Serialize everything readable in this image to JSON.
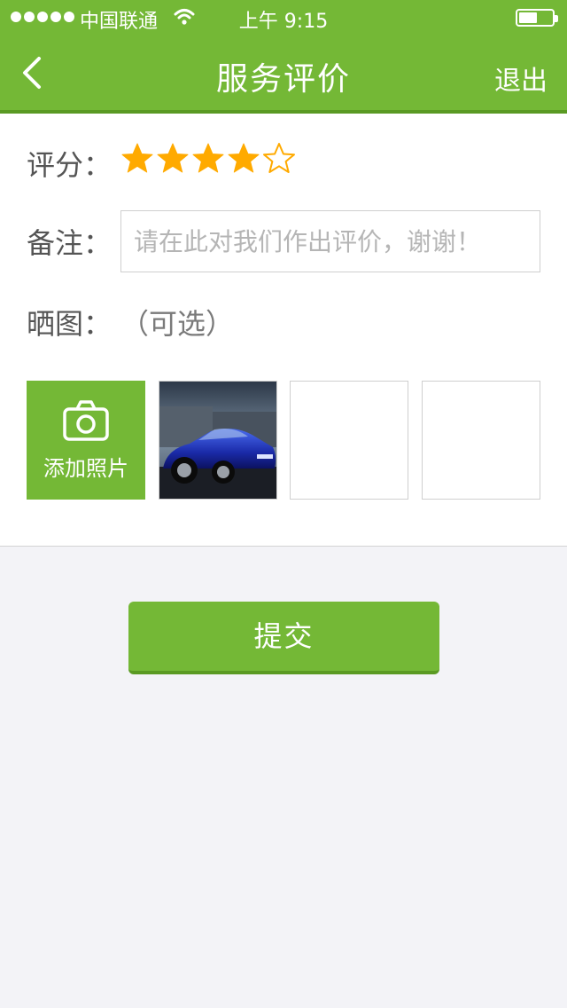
{
  "status_bar": {
    "carrier": "中国联通",
    "time": "上午 9:15",
    "signal_bars": 5,
    "battery_level": 0.55
  },
  "nav": {
    "title": "服务评价",
    "exit_label": "退出",
    "back_icon": "chevron-left-icon"
  },
  "form": {
    "rating_label": "评分：",
    "rating_value": 4,
    "rating_max": 5,
    "remark_label": "备注：",
    "remark_placeholder": "请在此对我们作出评价，谢谢！",
    "remark_value": "",
    "photos_label": "晒图：",
    "photos_optional": "（可选）",
    "add_photo_label": "添加照片",
    "add_photo_icon": "camera-icon"
  },
  "submit_label": "提交",
  "colors": {
    "brand": "#74b836",
    "brand_dark": "#5a9a23",
    "star": "#ffaa00"
  }
}
